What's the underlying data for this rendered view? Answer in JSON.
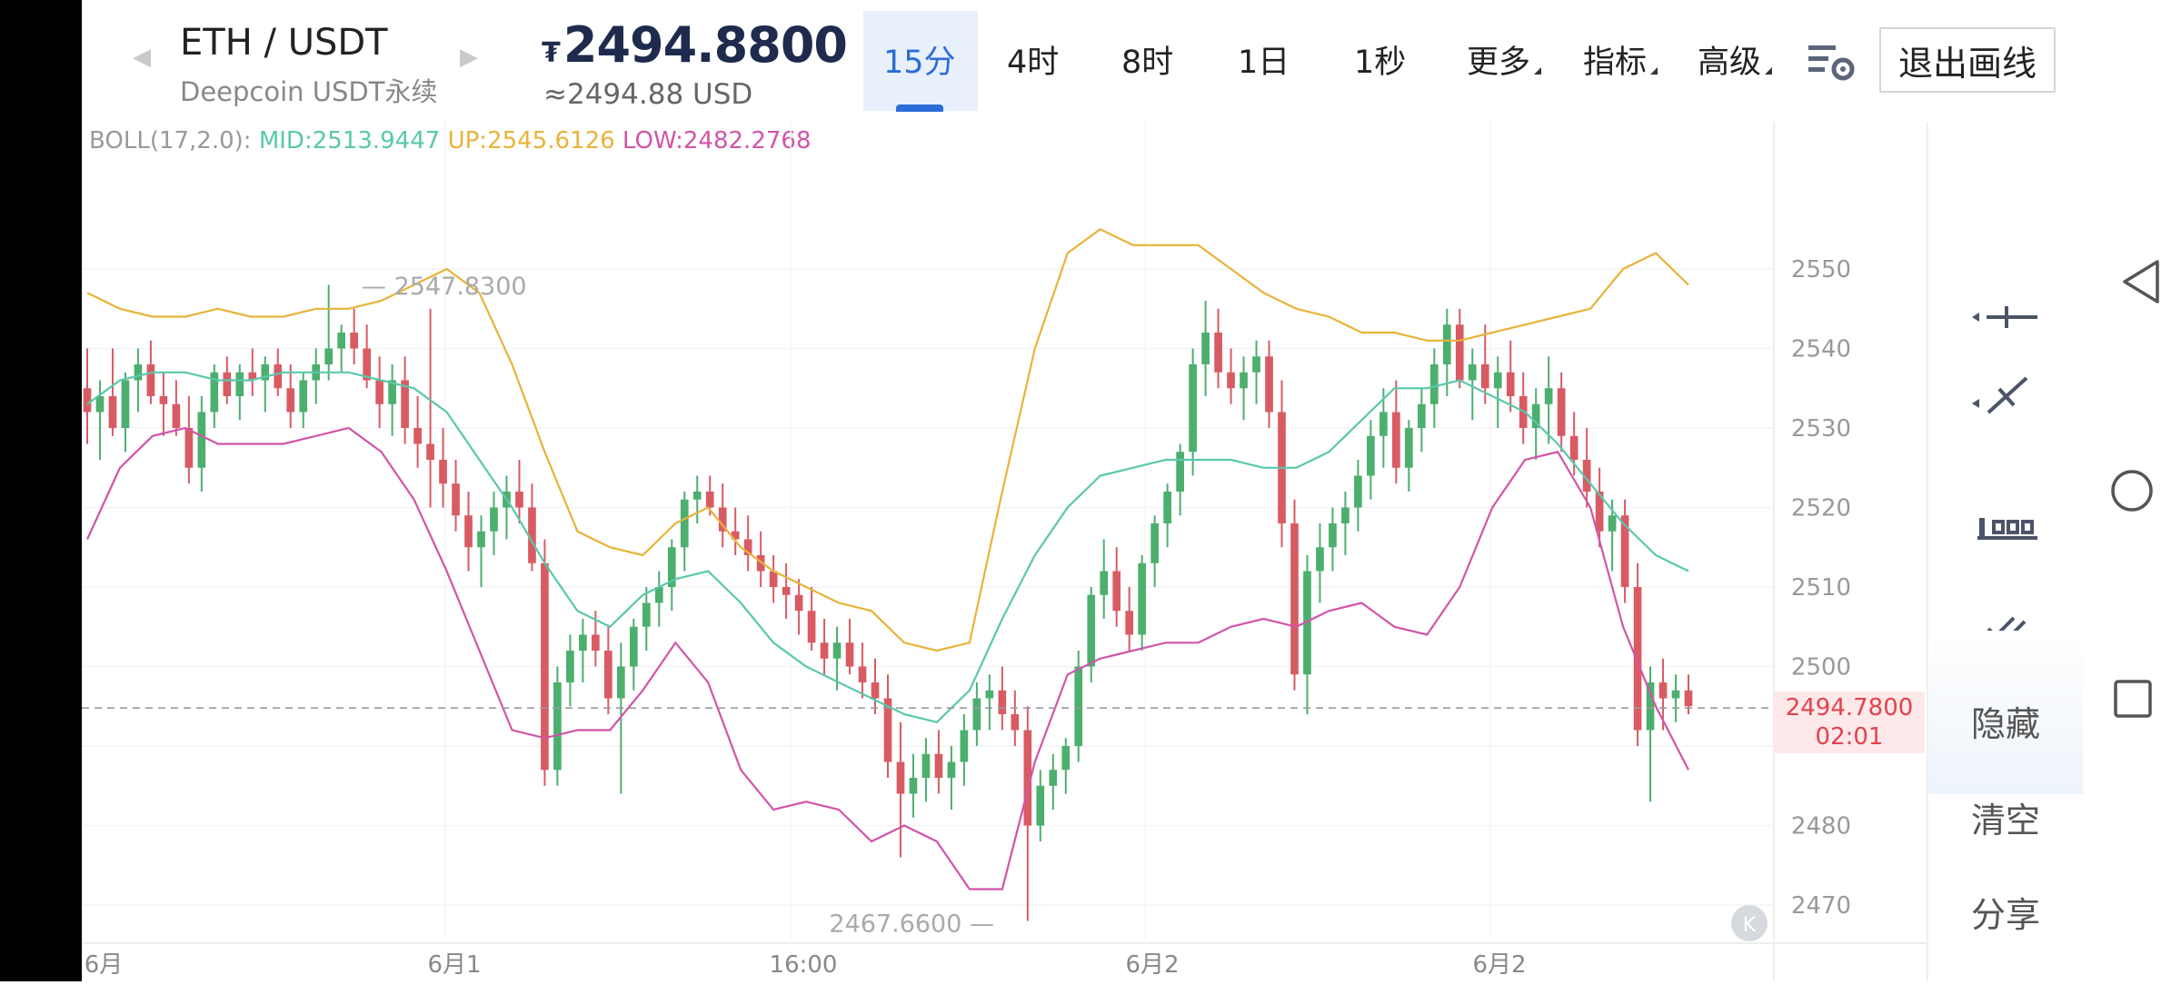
{
  "header": {
    "pair": "ETH / USDT",
    "pair_sub": "Deepcoin USDT永续",
    "price_currency": "₮",
    "price": "2494.8800",
    "price_usd": "≈2494.88 USD",
    "tabs": [
      {
        "label": "15分",
        "active": true
      },
      {
        "label": "4时"
      },
      {
        "label": "8时"
      },
      {
        "label": "1日"
      },
      {
        "label": "1秒"
      },
      {
        "label": "更多"
      },
      {
        "label": "指标"
      },
      {
        "label": "高级"
      }
    ],
    "exit_label": "退出画线"
  },
  "indicator": {
    "title": "BOLL(17,2.0):",
    "mid": "MID:2513.9447",
    "up": "UP:2545.6126",
    "low": "LOW:2482.2768"
  },
  "right_panel": {
    "hide_label": "隐藏",
    "clear_label": "清空",
    "share_label": "分享",
    "tools": [
      "horizontal-ray-tool-icon",
      "trend-line-tool-icon",
      "price-range-tool-icon",
      "parallel-channel-tool-icon",
      "fibonacci-tool-icon"
    ]
  },
  "colors": {
    "up": "#4caf6e",
    "down": "#d85b63",
    "boll_mid": "#5ac8aa",
    "boll_up": "#e8b33a",
    "boll_low": "#d155a8",
    "accent": "#2b6cd6"
  },
  "chart_data": {
    "type": "candlestick",
    "y_ticks": [
      "2550",
      "2540",
      "2530",
      "2520",
      "2510",
      "2500",
      "2480",
      "2470"
    ],
    "ylim": [
      2465,
      2562
    ],
    "x_labels": [
      "6月",
      "6月1",
      "16:00",
      "6月2",
      "6月2"
    ],
    "high_marker": "2547.8300",
    "low_marker": "2467.6600",
    "last_price": "2494.7800",
    "countdown": "02:01",
    "last_price_value": 2494.78,
    "candles": [
      [
        2535,
        2540,
        2528,
        2532
      ],
      [
        2532,
        2536,
        2526,
        2534
      ],
      [
        2534,
        2540,
        2529,
        2530
      ],
      [
        2530,
        2537,
        2527,
        2536
      ],
      [
        2536,
        2540,
        2532,
        2538
      ],
      [
        2538,
        2541,
        2533,
        2534
      ],
      [
        2534,
        2537,
        2529,
        2533
      ],
      [
        2533,
        2536,
        2529,
        2530
      ],
      [
        2530,
        2534,
        2523,
        2525
      ],
      [
        2525,
        2534,
        2522,
        2532
      ],
      [
        2532,
        2538,
        2530,
        2537
      ],
      [
        2537,
        2539,
        2533,
        2534
      ],
      [
        2534,
        2538,
        2531,
        2537
      ],
      [
        2537,
        2540,
        2534,
        2536
      ],
      [
        2536,
        2539,
        2532,
        2538
      ],
      [
        2538,
        2540,
        2534,
        2535
      ],
      [
        2535,
        2538,
        2530,
        2532
      ],
      [
        2532,
        2537,
        2530,
        2536
      ],
      [
        2536,
        2540,
        2533,
        2538
      ],
      [
        2538,
        2548,
        2536,
        2540
      ],
      [
        2540,
        2543,
        2537,
        2542
      ],
      [
        2542,
        2545,
        2538,
        2540
      ],
      [
        2540,
        2543,
        2535,
        2536
      ],
      [
        2536,
        2539,
        2530,
        2533
      ],
      [
        2533,
        2538,
        2529,
        2536
      ],
      [
        2536,
        2539,
        2528,
        2530
      ],
      [
        2530,
        2534,
        2525,
        2528
      ],
      [
        2528,
        2545,
        2520,
        2526
      ],
      [
        2526,
        2530,
        2520,
        2523
      ],
      [
        2523,
        2526,
        2517,
        2519
      ],
      [
        2519,
        2522,
        2512,
        2515
      ],
      [
        2515,
        2519,
        2510,
        2517
      ],
      [
        2517,
        2522,
        2514,
        2520
      ],
      [
        2520,
        2524,
        2516,
        2522
      ],
      [
        2522,
        2526,
        2518,
        2520
      ],
      [
        2520,
        2523,
        2512,
        2513
      ],
      [
        2513,
        2516,
        2485,
        2487
      ],
      [
        2487,
        2500,
        2485,
        2498
      ],
      [
        2498,
        2504,
        2495,
        2502
      ],
      [
        2502,
        2506,
        2498,
        2504
      ],
      [
        2504,
        2507,
        2500,
        2502
      ],
      [
        2502,
        2505,
        2494,
        2496
      ],
      [
        2496,
        2503,
        2484,
        2500
      ],
      [
        2500,
        2506,
        2497,
        2505
      ],
      [
        2505,
        2510,
        2502,
        2508
      ],
      [
        2508,
        2512,
        2505,
        2510
      ],
      [
        2510,
        2516,
        2507,
        2515
      ],
      [
        2515,
        2522,
        2512,
        2521
      ],
      [
        2521,
        2524,
        2518,
        2522
      ],
      [
        2522,
        2524,
        2519,
        2520
      ],
      [
        2520,
        2523,
        2515,
        2517
      ],
      [
        2517,
        2520,
        2514,
        2516
      ],
      [
        2516,
        2519,
        2512,
        2514
      ],
      [
        2514,
        2517,
        2510,
        2512
      ],
      [
        2512,
        2514,
        2508,
        2510
      ],
      [
        2510,
        2513,
        2506,
        2509
      ],
      [
        2509,
        2511,
        2504,
        2507
      ],
      [
        2507,
        2510,
        2502,
        2503
      ],
      [
        2503,
        2506,
        2499,
        2501
      ],
      [
        2501,
        2505,
        2497,
        2503
      ],
      [
        2503,
        2506,
        2499,
        2500
      ],
      [
        2500,
        2503,
        2496,
        2498
      ],
      [
        2498,
        2501,
        2494,
        2496
      ],
      [
        2496,
        2499,
        2486,
        2488
      ],
      [
        2488,
        2493,
        2476,
        2484
      ],
      [
        2484,
        2489,
        2481,
        2486
      ],
      [
        2486,
        2491,
        2483,
        2489
      ],
      [
        2489,
        2492,
        2484,
        2486
      ],
      [
        2486,
        2490,
        2482,
        2488
      ],
      [
        2488,
        2494,
        2485,
        2492
      ],
      [
        2492,
        2498,
        2490,
        2496
      ],
      [
        2496,
        2499,
        2492,
        2497
      ],
      [
        2497,
        2500,
        2492,
        2494
      ],
      [
        2494,
        2497,
        2490,
        2492
      ],
      [
        2492,
        2495,
        2468,
        2480
      ],
      [
        2480,
        2487,
        2478,
        2485
      ],
      [
        2485,
        2489,
        2482,
        2487
      ],
      [
        2487,
        2491,
        2484,
        2490
      ],
      [
        2490,
        2502,
        2488,
        2500
      ],
      [
        2500,
        2510,
        2498,
        2509
      ],
      [
        2509,
        2516,
        2506,
        2512
      ],
      [
        2512,
        2515,
        2505,
        2507
      ],
      [
        2507,
        2510,
        2502,
        2504
      ],
      [
        2504,
        2514,
        2502,
        2513
      ],
      [
        2513,
        2519,
        2510,
        2518
      ],
      [
        2518,
        2523,
        2515,
        2522
      ],
      [
        2522,
        2528,
        2519,
        2527
      ],
      [
        2527,
        2540,
        2524,
        2538
      ],
      [
        2538,
        2546,
        2534,
        2542
      ],
      [
        2542,
        2545,
        2535,
        2537
      ],
      [
        2537,
        2540,
        2533,
        2535
      ],
      [
        2535,
        2539,
        2531,
        2537
      ],
      [
        2537,
        2541,
        2533,
        2539
      ],
      [
        2539,
        2541,
        2530,
        2532
      ],
      [
        2532,
        2536,
        2515,
        2518
      ],
      [
        2518,
        2521,
        2497,
        2499
      ],
      [
        2499,
        2514,
        2494,
        2512
      ],
      [
        2512,
        2518,
        2508,
        2515
      ],
      [
        2515,
        2520,
        2512,
        2518
      ],
      [
        2518,
        2522,
        2514,
        2520
      ],
      [
        2520,
        2526,
        2517,
        2524
      ],
      [
        2524,
        2531,
        2521,
        2529
      ],
      [
        2529,
        2535,
        2525,
        2532
      ],
      [
        2532,
        2536,
        2523,
        2525
      ],
      [
        2525,
        2531,
        2522,
        2530
      ],
      [
        2530,
        2535,
        2527,
        2533
      ],
      [
        2533,
        2540,
        2530,
        2538
      ],
      [
        2538,
        2545,
        2534,
        2543
      ],
      [
        2543,
        2545,
        2535,
        2536
      ],
      [
        2536,
        2540,
        2531,
        2538
      ],
      [
        2538,
        2543,
        2533,
        2535
      ],
      [
        2535,
        2539,
        2530,
        2537
      ],
      [
        2537,
        2541,
        2532,
        2534
      ],
      [
        2534,
        2537,
        2528,
        2530
      ],
      [
        2530,
        2535,
        2526,
        2533
      ],
      [
        2533,
        2539,
        2528,
        2535
      ],
      [
        2535,
        2537,
        2527,
        2529
      ],
      [
        2529,
        2532,
        2524,
        2526
      ],
      [
        2526,
        2530,
        2520,
        2522
      ],
      [
        2522,
        2525,
        2515,
        2517
      ],
      [
        2517,
        2521,
        2512,
        2519
      ],
      [
        2519,
        2521,
        2508,
        2510
      ],
      [
        2510,
        2513,
        2490,
        2492
      ],
      [
        2492,
        2500,
        2483,
        2498
      ],
      [
        2498,
        2501,
        2492,
        2496
      ],
      [
        2496,
        2499,
        2493,
        2497
      ],
      [
        2497,
        2499,
        2494,
        2495
      ]
    ],
    "boll_up": [
      2547,
      2545,
      2544,
      2544,
      2545,
      2544,
      2544,
      2545,
      2545,
      2546,
      2548,
      2550,
      2547,
      2538,
      2527,
      2517,
      2515,
      2514,
      2518,
      2520,
      2515,
      2512,
      2510,
      2508,
      2507,
      2503,
      2502,
      2503,
      2522,
      2540,
      2552,
      2555,
      2553,
      2553,
      2553,
      2550,
      2547,
      2545,
      2544,
      2542,
      2542,
      2541,
      2541,
      2542,
      2543,
      2544,
      2545,
      2550,
      2552,
      2548
    ],
    "boll_mid": [
      2533,
      2536,
      2537,
      2537,
      2536,
      2536,
      2537,
      2537,
      2537,
      2536,
      2535,
      2532,
      2526,
      2520,
      2513,
      2507,
      2505,
      2509,
      2511,
      2512,
      2508,
      2503,
      2500,
      2498,
      2496,
      2494,
      2493,
      2497,
      2506,
      2514,
      2520,
      2524,
      2525,
      2526,
      2526,
      2526,
      2525,
      2525,
      2527,
      2531,
      2535,
      2535,
      2536,
      2534,
      2532,
      2528,
      2523,
      2518,
      2514,
      2512
    ],
    "boll_low": [
      2516,
      2525,
      2529,
      2530,
      2528,
      2528,
      2528,
      2529,
      2530,
      2527,
      2521,
      2512,
      2502,
      2492,
      2491,
      2492,
      2492,
      2497,
      2503,
      2498,
      2487,
      2482,
      2483,
      2482,
      2478,
      2480,
      2478,
      2472,
      2472,
      2488,
      2499,
      2501,
      2502,
      2503,
      2503,
      2505,
      2506,
      2505,
      2507,
      2508,
      2505,
      2504,
      2510,
      2520,
      2526,
      2527,
      2520,
      2505,
      2495,
      2487
    ]
  }
}
